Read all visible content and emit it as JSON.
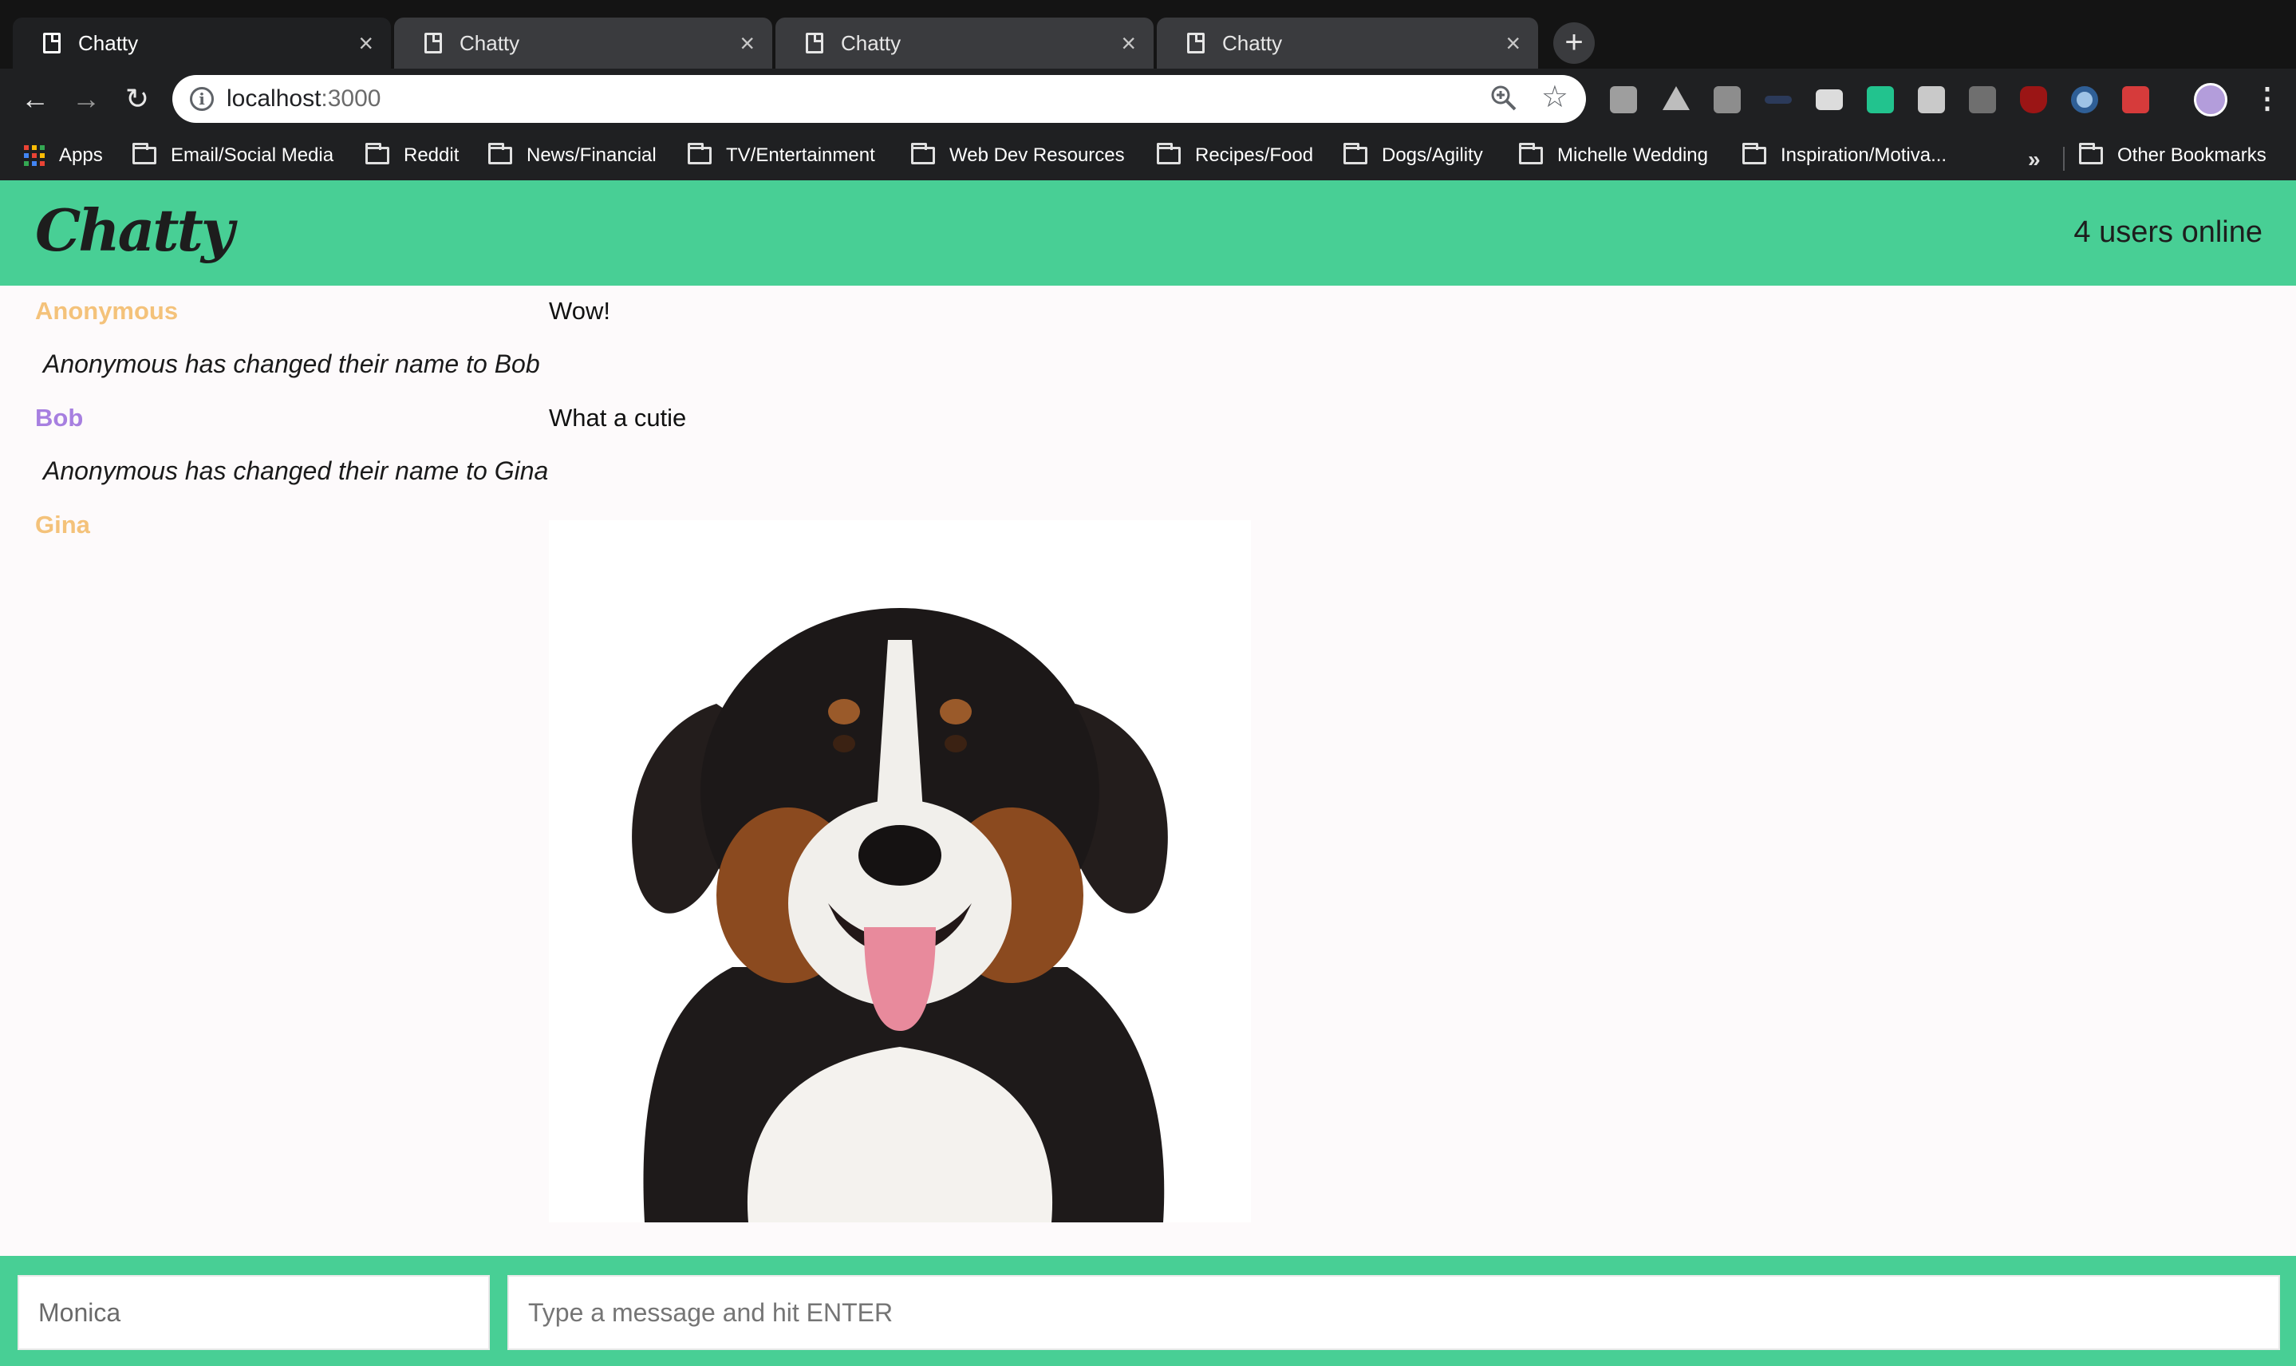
{
  "browser": {
    "tabs": [
      {
        "title": "Chatty",
        "close": "×"
      },
      {
        "title": "Chatty",
        "close": "×"
      },
      {
        "title": "Chatty",
        "close": "×"
      },
      {
        "title": "Chatty",
        "close": "×"
      }
    ],
    "new_tab": "+",
    "url_host": "localhost",
    "url_port": ":3000",
    "bookmarks": [
      "Apps",
      "Email/Social Media",
      "Reddit",
      "News/Financial",
      "TV/Entertainment",
      "Web Dev Resources",
      "Recipes/Food",
      "Dogs/Agility",
      "Michelle Wedding",
      "Inspiration/Motiva...",
      "Other Bookmarks"
    ],
    "overflow": "»"
  },
  "app": {
    "brand": "Chatty",
    "users_online": "4 users online",
    "messages": [
      {
        "username": "Anonymous",
        "content": "Wow!",
        "color": "#f4c27a"
      },
      {
        "notice": "Anonymous has changed their name to Bob"
      },
      {
        "username": "Bob",
        "content": "What a cutie",
        "color": "#a77fe0"
      },
      {
        "notice": "Anonymous has changed their name to Gina"
      },
      {
        "username": "Gina",
        "content_image": "dog photo",
        "color": "#f4c27a"
      }
    ],
    "chatbar": {
      "username_value": "Monica",
      "message_placeholder": "Type a message and hit ENTER"
    }
  },
  "colors": {
    "accent": "#48cf95",
    "anonymous": "#f4c27a",
    "bob": "#a77fe0",
    "gina": "#f4c27a"
  }
}
